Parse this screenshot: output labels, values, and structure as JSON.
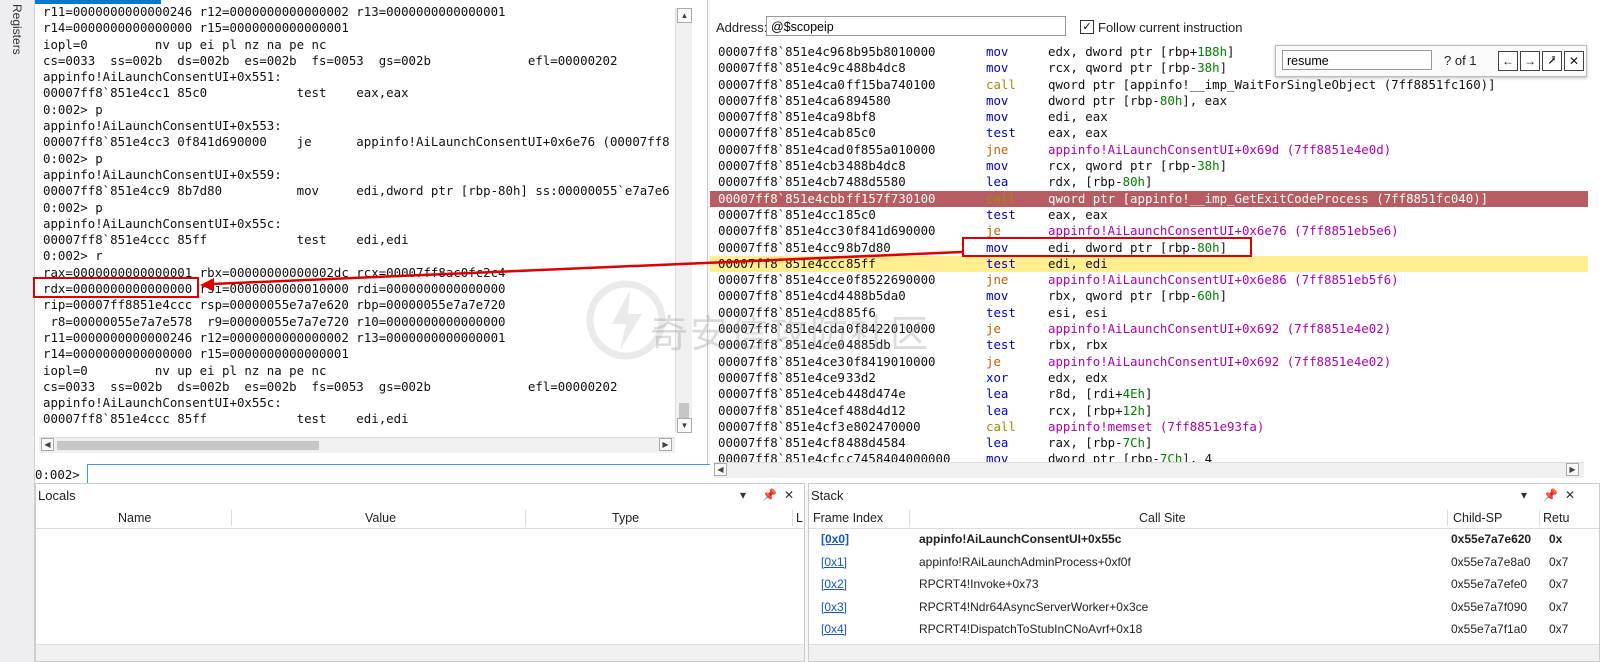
{
  "left_tab": {
    "label": "Registers"
  },
  "command": {
    "output_lines": [
      "r11=0000000000000246 r12=0000000000000002 r13=0000000000000001",
      "r14=0000000000000000 r15=0000000000000001",
      "iopl=0         nv up ei pl nz na pe nc",
      "cs=0033  ss=002b  ds=002b  es=002b  fs=0053  gs=002b             efl=00000202",
      "appinfo!AiLaunchConsentUI+0x551:",
      "00007ff8`851e4cc1 85c0            test    eax,eax",
      "0:002> p",
      "appinfo!AiLaunchConsentUI+0x553:",
      "00007ff8`851e4cc3 0f841d690000    je      appinfo!AiLaunchConsentUI+0x6e76 (00007ff8",
      "0:002> p",
      "appinfo!AiLaunchConsentUI+0x559:",
      "00007ff8`851e4cc9 8b7d80          mov     edi,dword ptr [rbp-80h] ss:00000055`e7a7e6",
      "0:002> p",
      "appinfo!AiLaunchConsentUI+0x55c:",
      "00007ff8`851e4ccc 85ff            test    edi,edi",
      "0:002> r",
      "rax=0000000000000001 rbx=00000000000002dc rcx=00007ff8ac0fc2c4",
      "rdx=0000000000000000 rsi=0000000000010000 rdi=0000000000000000",
      "rip=00007ff8851e4ccc rsp=00000055e7a7e620 rbp=00000055e7a7e720",
      " r8=00000055e7a7e578  r9=00000055e7a7e720 r10=0000000000000000",
      "r11=0000000000000246 r12=0000000000000002 r13=0000000000000001",
      "r14=0000000000000000 r15=0000000000000001",
      "iopl=0         nv up ei pl nz na pe nc",
      "cs=0033  ss=002b  ds=002b  es=002b  fs=0053  gs=002b             efl=00000202",
      "appinfo!AiLaunchConsentUI+0x55c:",
      "00007ff8`851e4ccc 85ff            test    edi,edi"
    ],
    "prompt": "0:002>",
    "input_value": ""
  },
  "disassembly": {
    "address_label": "Address:",
    "address_value": "@$scopeip",
    "follow_label": "Follow current instruction",
    "follow_checked": "✓",
    "lines": [
      {
        "addr": "00007ff8`851e4c96",
        "bytes": "8b95b8010000",
        "mn": "mov",
        "ops": [
          "edx, dword ptr [rbp+",
          "1B8h",
          "]"
        ]
      },
      {
        "addr": "00007ff8`851e4c9c",
        "bytes": "488b4dc8",
        "mn": "mov",
        "ops": [
          "rcx, qword ptr [rbp-",
          "38h",
          "]"
        ]
      },
      {
        "addr": "00007ff8`851e4ca0",
        "bytes": "ff15ba740100",
        "mn": "call",
        "ops": [
          "qword ptr [appinfo!__imp_WaitForSingleObject (7ff8851fc160)]"
        ]
      },
      {
        "addr": "00007ff8`851e4ca6",
        "bytes": "894580",
        "mn": "mov",
        "ops": [
          "dword ptr [rbp-",
          "80h",
          "], eax"
        ]
      },
      {
        "addr": "00007ff8`851e4ca9",
        "bytes": "8bf8",
        "mn": "mov",
        "ops": [
          "edi, eax"
        ]
      },
      {
        "addr": "00007ff8`851e4cab",
        "bytes": "85c0",
        "mn": "test",
        "ops": [
          "eax, eax"
        ]
      },
      {
        "addr": "00007ff8`851e4cad",
        "bytes": "0f855a010000",
        "mn": "jne",
        "ops": [
          "appinfo!AiLaunchConsentUI+0x69d (7ff8851e4e0d)"
        ]
      },
      {
        "addr": "00007ff8`851e4cb3",
        "bytes": "488b4dc8",
        "mn": "mov",
        "ops": [
          "rcx, qword ptr [rbp-",
          "38h",
          "]"
        ]
      },
      {
        "addr": "00007ff8`851e4cb7",
        "bytes": "488d5580",
        "mn": "lea",
        "ops": [
          "rdx, [rbp-",
          "80h",
          "]"
        ]
      },
      {
        "addr": "00007ff8`851e4cbb",
        "bytes": "ff157f730100",
        "mn": "call",
        "ops": [
          "qword ptr [appinfo!__imp_GetExitCodeProcess (7ff8851fc040)]"
        ]
      },
      {
        "addr": "00007ff8`851e4cc1",
        "bytes": "85c0",
        "mn": "test",
        "ops": [
          "eax, eax"
        ]
      },
      {
        "addr": "00007ff8`851e4cc3",
        "bytes": "0f841d690000",
        "mn": "je",
        "ops": [
          "appinfo!AiLaunchConsentUI+0x6e76 (7ff8851eb5e6)"
        ]
      },
      {
        "addr": "00007ff8`851e4cc9",
        "bytes": "8b7d80",
        "mn": "mov",
        "ops": [
          "edi, dword ptr [rbp-",
          "80h",
          "]"
        ]
      },
      {
        "addr": "00007ff8`851e4ccc",
        "bytes": "85ff",
        "mn": "test",
        "ops": [
          "edi, edi"
        ]
      },
      {
        "addr": "00007ff8`851e4cce",
        "bytes": "0f8522690000",
        "mn": "jne",
        "ops": [
          "appinfo!AiLaunchConsentUI+0x6e86 (7ff8851eb5f6)"
        ]
      },
      {
        "addr": "00007ff8`851e4cd4",
        "bytes": "488b5da0",
        "mn": "mov",
        "ops": [
          "rbx, qword ptr [rbp-",
          "60h",
          "]"
        ]
      },
      {
        "addr": "00007ff8`851e4cd8",
        "bytes": "85f6",
        "mn": "test",
        "ops": [
          "esi, esi"
        ]
      },
      {
        "addr": "00007ff8`851e4cda",
        "bytes": "0f8422010000",
        "mn": "je",
        "ops": [
          "appinfo!AiLaunchConsentUI+0x692 (7ff8851e4e02)"
        ]
      },
      {
        "addr": "00007ff8`851e4ce0",
        "bytes": "4885db",
        "mn": "test",
        "ops": [
          "rbx, rbx"
        ]
      },
      {
        "addr": "00007ff8`851e4ce3",
        "bytes": "0f8419010000",
        "mn": "je",
        "ops": [
          "appinfo!AiLaunchConsentUI+0x692 (7ff8851e4e02)"
        ]
      },
      {
        "addr": "00007ff8`851e4ce9",
        "bytes": "33d2",
        "mn": "xor",
        "ops": [
          "edx, edx"
        ]
      },
      {
        "addr": "00007ff8`851e4ceb",
        "bytes": "448d474e",
        "mn": "lea",
        "ops": [
          "r8d, [rdi+",
          "4Eh",
          "]"
        ]
      },
      {
        "addr": "00007ff8`851e4cef",
        "bytes": "488d4d12",
        "mn": "lea",
        "ops": [
          "rcx, [rbp+",
          "12h",
          "]"
        ]
      },
      {
        "addr": "00007ff8`851e4cf3",
        "bytes": "e802470000",
        "mn": "call",
        "ops": [
          "appinfo!memset (7ff8851e93fa)"
        ]
      },
      {
        "addr": "00007ff8`851e4cf8",
        "bytes": "488d4584",
        "mn": "lea",
        "ops": [
          "rax, [rbp-",
          "7Ch",
          "]"
        ]
      },
      {
        "addr": "00007ff8`851e4cfc",
        "bytes": "c7458404000000",
        "mn": "mov",
        "ops": [
          "dword ptr [rbp-",
          "7Ch",
          "], 4"
        ]
      }
    ],
    "breakpoint_index": 9,
    "current_index": 13
  },
  "find": {
    "query": "resume",
    "count": "? of 1",
    "prev": "←",
    "next": "→",
    "pin": "⭷",
    "close": "✕"
  },
  "locals": {
    "title": "Locals",
    "columns": [
      "Name",
      "Value",
      "Type",
      "L"
    ]
  },
  "stack": {
    "title": "Stack",
    "columns": [
      "Frame Index",
      "Call Site",
      "Child-SP",
      "Retu"
    ],
    "rows": [
      {
        "frame": "[0x0]",
        "site": "appinfo!AiLaunchConsentUI+0x55c",
        "sp": "0x55e7a7e620",
        "ret": "0x"
      },
      {
        "frame": "[0x1]",
        "site": "appinfo!RAiLaunchAdminProcess+0xf0f",
        "sp": "0x55e7a7e8a0",
        "ret": "0x7"
      },
      {
        "frame": "[0x2]",
        "site": "RPCRT4!Invoke+0x73",
        "sp": "0x55e7a7efe0",
        "ret": "0x7"
      },
      {
        "frame": "[0x3]",
        "site": "RPCRT4!Ndr64AsyncServerWorker+0x3ce",
        "sp": "0x55e7a7f090",
        "ret": "0x7"
      },
      {
        "frame": "[0x4]",
        "site": "RPCRT4!DispatchToStubInCNoAvrf+0x18",
        "sp": "0x55e7a7f1a0",
        "ret": "0x7"
      }
    ]
  },
  "panel_icons": {
    "dropdown": "▾",
    "pin": "📌",
    "close": "✕"
  },
  "watermark": "奇安信攻防社区"
}
